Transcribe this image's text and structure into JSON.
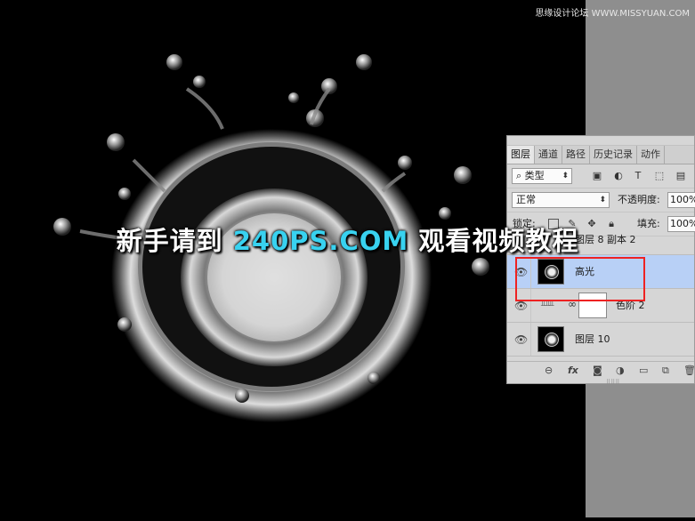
{
  "watermark": "思缘设计论坛 WWW.MISSYUAN.COM",
  "banner": {
    "prefix": "新手请到",
    "highlight": "240PS.COM",
    "suffix": "观看视频教程"
  },
  "panel": {
    "tabs": [
      "图层",
      "通道",
      "路径",
      "历史记录",
      "动作"
    ],
    "filter": {
      "label": "类型",
      "icons": [
        "image-filter-icon",
        "adjustment-filter-icon",
        "type-filter-icon",
        "shape-filter-icon",
        "smart-object-filter-icon"
      ]
    },
    "blend_mode": "正常",
    "opacity_label": "不透明度:",
    "opacity_value": "100%",
    "lock_label": "锁定:",
    "fill_label": "填充:",
    "fill_value": "100%",
    "layers": [
      {
        "name": "图层 8 副本 2",
        "visible": false,
        "selected": false
      },
      {
        "name": "高光",
        "visible": true,
        "selected": true
      },
      {
        "name": "色阶 2",
        "visible": true,
        "selected": false,
        "adjustment": "levels"
      },
      {
        "name": "图层 10",
        "visible": true,
        "selected": false
      }
    ],
    "footer_icons": [
      "link-icon",
      "fx-icon",
      "mask-icon",
      "adjustment-icon",
      "folder-icon",
      "new-layer-icon",
      "delete-icon"
    ]
  },
  "colors": {
    "selection": "#b8d0f6",
    "highlight_box": "#e22222",
    "banner_accent": "#38d2f0"
  }
}
